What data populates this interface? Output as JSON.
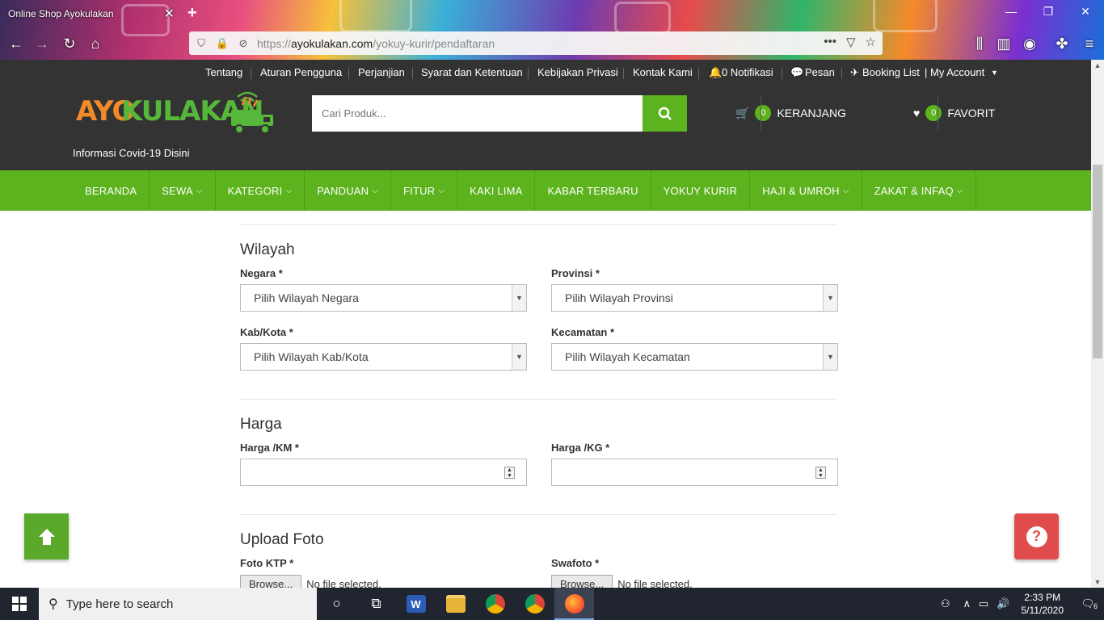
{
  "browser": {
    "tab_title": "Online Shop Ayokulakan",
    "url_protocol": "https://",
    "url_domain": "ayokulakan.com",
    "url_path": "/yokuy-kurir/pendaftaran"
  },
  "header": {
    "top_links": [
      "Tentang",
      "Aturan Pengguna",
      "Perjanjian",
      "Syarat dan Ketentuan",
      "Kebijakan Privasi",
      "Kontak Kami",
      "0 Notifikasi",
      "Pesan",
      "Booking List",
      "| My Account"
    ],
    "logo_part1": "AYO",
    "logo_part2": "KULAKAN",
    "covid_link": "Informasi Covid-19 Disini",
    "search_placeholder": "Cari Produk...",
    "cart_count": "0",
    "cart_label": "KERANJANG",
    "fav_count": "0",
    "fav_label": "FAVORIT"
  },
  "nav": {
    "items": [
      "BERANDA",
      "SEWA",
      "KATEGORI",
      "PANDUAN",
      "FITUR",
      "KAKI LIMA",
      "KABAR TERBARU",
      "YOKUY KURIR",
      "HAJI & UMROH",
      "ZAKAT & INFAQ"
    ]
  },
  "form": {
    "wilayah_title": "Wilayah",
    "negara_label": "Negara *",
    "negara_value": "Pilih Wilayah Negara",
    "provinsi_label": "Provinsi *",
    "provinsi_value": "Pilih Wilayah Provinsi",
    "kabkota_label": "Kab/Kota *",
    "kabkota_value": "Pilih Wilayah Kab/Kota",
    "kecamatan_label": "Kecamatan *",
    "kecamatan_value": "Pilih Wilayah Kecamatan",
    "harga_title": "Harga",
    "harga_km_label": "Harga /KM *",
    "harga_kg_label": "Harga /KG *",
    "upload_title": "Upload Foto",
    "ktp_label": "Foto KTP *",
    "swafoto_label": "Swafoto *",
    "browse_label": "Browse...",
    "no_file": "No file selected."
  },
  "taskbar": {
    "search_text": "Type here to search",
    "time": "2:33 PM",
    "date": "5/11/2020",
    "notif_count": "6"
  },
  "colors": {
    "header_bg": "#333333",
    "nav_green": "#5cb31d",
    "help_red": "#e04c4c"
  }
}
